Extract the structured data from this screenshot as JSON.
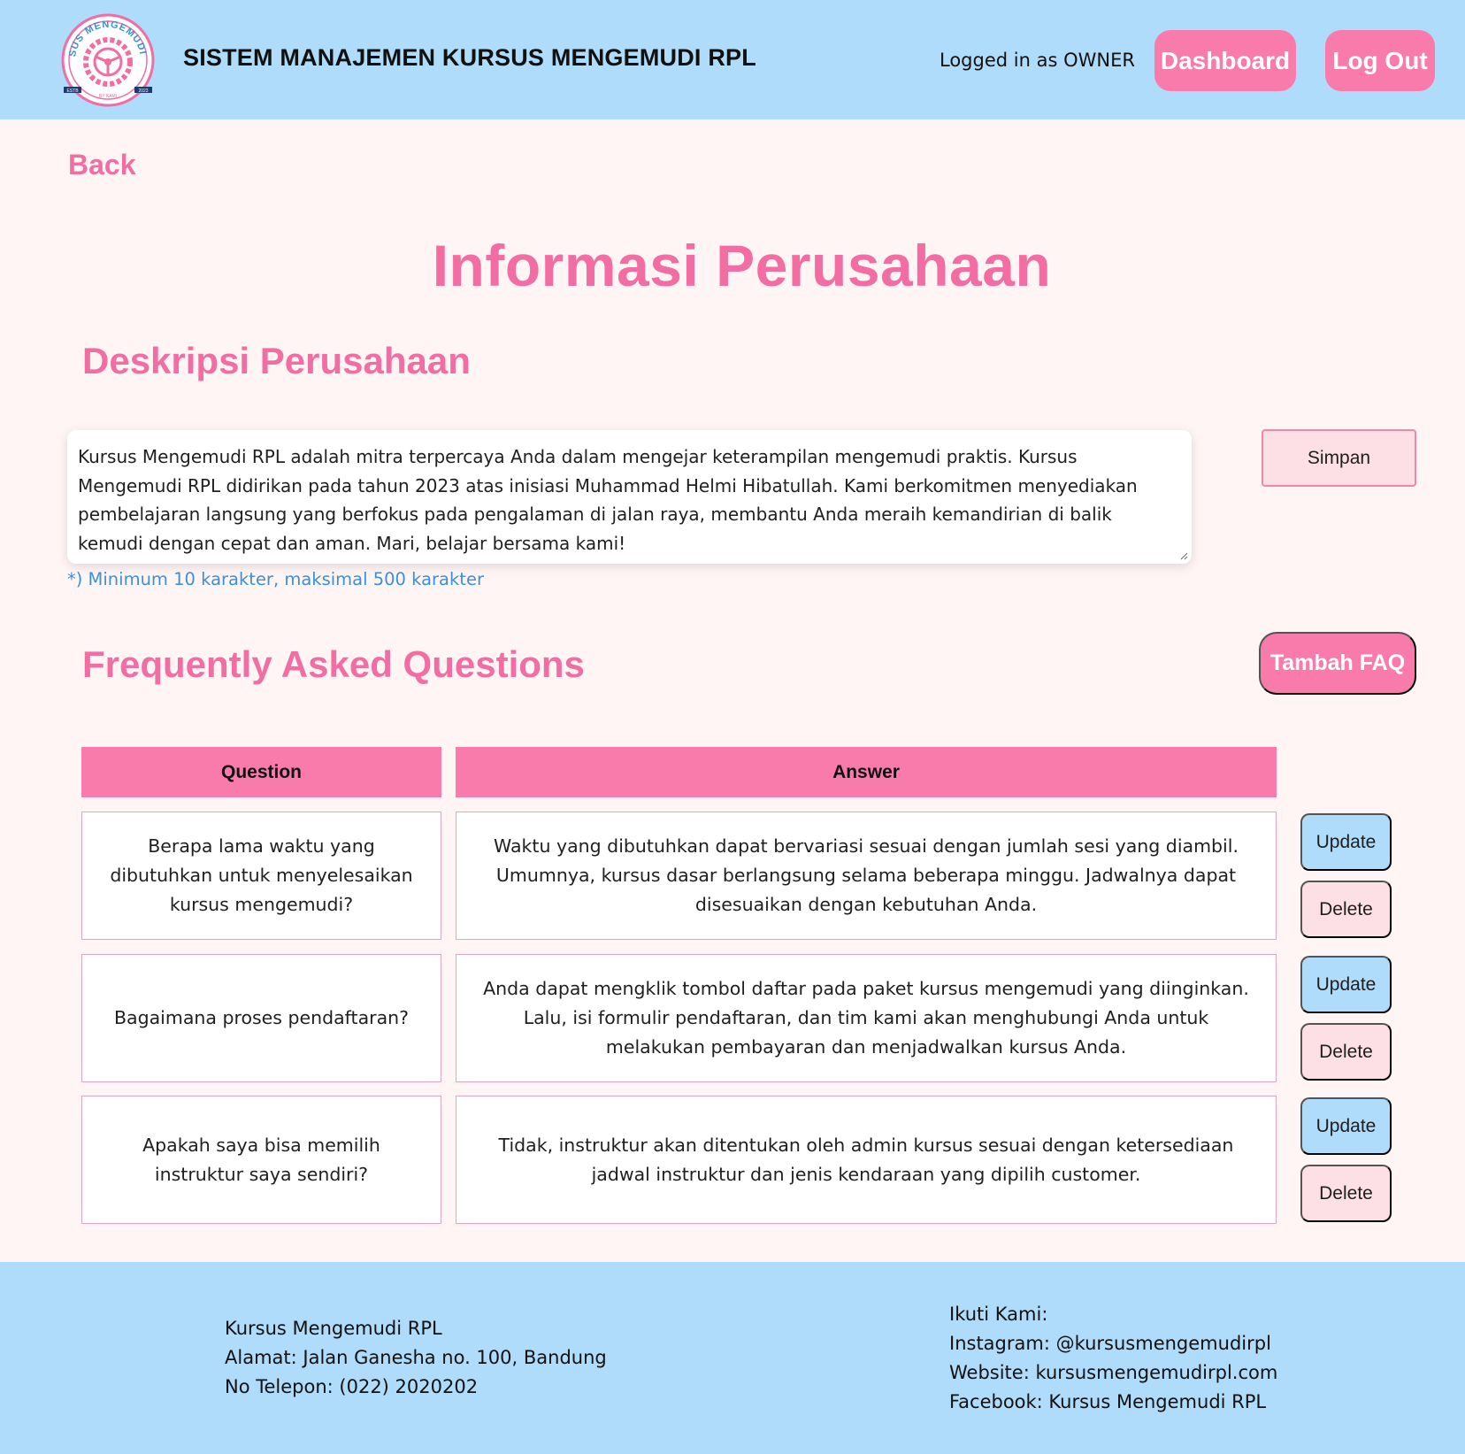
{
  "header": {
    "logo_text": "KURSUS MENGEMUDI RPL",
    "logo_subtext": "BY KAMI",
    "logo_est": "ESTB",
    "logo_year": "2023",
    "title": "SISTEM MANAJEMEN KURSUS MENGEMUDI RPL",
    "logged_in": "Logged in as OWNER",
    "dashboard_label": "Dashboard",
    "logout_label": "Log Out"
  },
  "back_label": "Back",
  "page_title": "Informasi Perusahaan",
  "description": {
    "title": "Deskripsi Perusahaan",
    "value": "Kursus Mengemudi RPL adalah mitra terpercaya Anda dalam mengejar keterampilan mengemudi praktis. Kursus Mengemudi RPL didirikan pada tahun 2023 atas inisiasi Muhammad Helmi Hibatullah. Kami berkomitmen menyediakan pembelajaran langsung yang berfokus pada pengalaman di jalan raya, membantu Anda meraih kemandirian di balik kemudi dengan cepat dan aman. Mari, belajar bersama kami!",
    "hint": "*) Minimum 10 karakter, maksimal 500 karakter",
    "save_label": "Simpan"
  },
  "faq": {
    "title": "Frequently Asked Questions",
    "add_label": "Tambah FAQ",
    "columns": [
      "Question",
      "Answer"
    ],
    "update_label": "Update",
    "delete_label": "Delete",
    "rows": [
      {
        "question": "Berapa lama waktu yang dibutuhkan untuk menyelesaikan kursus mengemudi?",
        "answer": "Waktu yang dibutuhkan dapat bervariasi sesuai dengan jumlah sesi yang diambil. Umumnya, kursus dasar berlangsung selama beberapa minggu. Jadwalnya dapat disesuaikan dengan kebutuhan Anda."
      },
      {
        "question": "Bagaimana proses pendaftaran?",
        "answer": "Anda dapat mengklik tombol daftar pada paket kursus mengemudi yang diinginkan. Lalu, isi formulir pendaftaran, dan tim kami akan menghubungi Anda untuk melakukan pembayaran dan menjadwalkan kursus Anda."
      },
      {
        "question": "Apakah saya bisa memilih instruktur saya sendiri?",
        "answer": "Tidak, instruktur akan ditentukan oleh admin kursus sesuai dengan ketersediaan jadwal instruktur dan jenis kendaraan yang dipilih customer."
      }
    ]
  },
  "footer": {
    "company": "Kursus Mengemudi RPL",
    "address": "Alamat: Jalan Ganesha no. 100, Bandung",
    "phone": "No Telepon: (022) 2020202",
    "follow": "Ikuti Kami:",
    "instagram": "Instagram: @kursusmengemudirpl",
    "website": "Website: kursusmengemudirpl.com",
    "facebook": "Facebook: Kursus Mengemudi RPL"
  },
  "colors": {
    "header_bg": "#aedcfa",
    "accent_pink": "#f87bac",
    "title_pink": "#f26ea2",
    "page_bg": "#fff5f5",
    "hint_blue": "#3d8fd6",
    "delete_bg": "#fde0e6"
  }
}
